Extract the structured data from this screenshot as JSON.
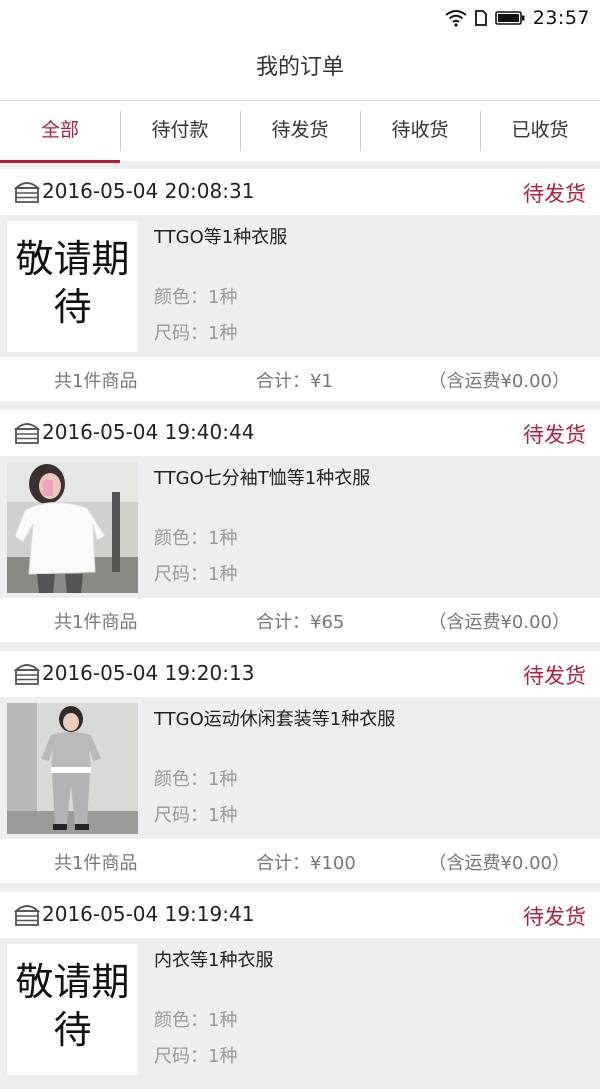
{
  "status_bar": {
    "time": "23:57"
  },
  "header": {
    "title": "我的订单"
  },
  "tabs": [
    {
      "label": "全部",
      "active": true
    },
    {
      "label": "待付款",
      "active": false
    },
    {
      "label": "待发货",
      "active": false
    },
    {
      "label": "待收货",
      "active": false
    },
    {
      "label": "已收货",
      "active": false
    }
  ],
  "colors": {
    "accent": "#b51d3b",
    "background": "#eeeeee"
  },
  "orders": [
    {
      "date": "2016-05-04 20:08:31",
      "status": "待发货",
      "thumb_text": "敬请期待",
      "title": "TTGO等1种衣服",
      "color": "颜色：1种",
      "size": "尺码：1种",
      "count": "共1件商品",
      "total": "合计：¥1",
      "shipping": "（含运费¥0.00）"
    },
    {
      "date": "2016-05-04 19:40:44",
      "status": "待发货",
      "thumb_image": "white-chiffon-top-photo",
      "title": "TTGO七分袖T恤等1种衣服",
      "color": "颜色：1种",
      "size": "尺码：1种",
      "count": "共1件商品",
      "total": "合计：¥65",
      "shipping": "（含运费¥0.00）"
    },
    {
      "date": "2016-05-04 19:20:13",
      "status": "待发货",
      "thumb_image": "grey-sport-suit-photo",
      "title": "TTGO运动休闲套装等1种衣服",
      "color": "颜色：1种",
      "size": "尺码：1种",
      "count": "共1件商品",
      "total": "合计：¥100",
      "shipping": "（含运费¥0.00）"
    },
    {
      "date": "2016-05-04 19:19:41",
      "status": "待发货",
      "thumb_text": "敬请期待",
      "title": "内衣等1种衣服",
      "color": "颜色：1种",
      "size": "尺码：1种"
    }
  ]
}
